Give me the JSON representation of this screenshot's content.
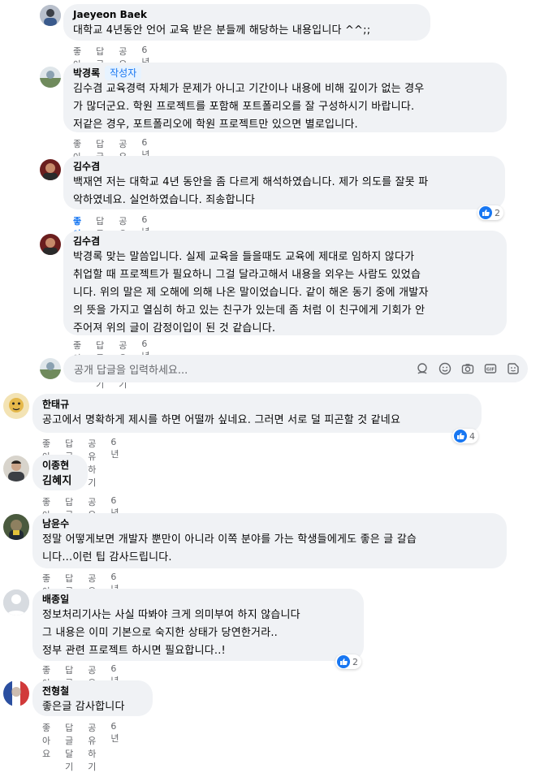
{
  "action_labels": {
    "like": "좋아요",
    "reply": "답글 달기",
    "share": "공유하기"
  },
  "reply_box": {
    "placeholder": "공개 답글을 입력하세요..."
  },
  "comments": [
    {
      "author": "Jaeyeon Baek",
      "text": "대학교 4년동안 언어 교육 받은 분들께 해당하는 내용입니다 ^^;;",
      "time": "6년"
    },
    {
      "author": "박경록",
      "badge": "작성자",
      "text": "김수겸 교육경력 자체가 문제가 아니고 기간이나 내용에 비해 깊이가 없는 경우\n가 많더군요. 학원 프로젝트를 포함해 포트폴리오를 잘 구성하시기 바랍니다.\n저같은 경우, 포트폴리오에 학원 프로젝트만 있으면 별로입니다.",
      "time": "6년"
    },
    {
      "author": "김수겸",
      "text": "백재연 저는 대학교 4년 동안을 좀 다르게 해석하였습니다. 제가 의도를 잘못 파\n악하였네요. 실언하였습니다. 죄송합니다",
      "time": "6년",
      "reactions": "2",
      "liked": true
    },
    {
      "author": "김수겸",
      "text": "박경록 맞는 말씀입니다. 실제 교육을 들을때도 교육에 제대로 임하지 않다가\n취업할 때 프로젝트가 필요하니 그걸 달라고해서 내용을 외우는 사람도 있었습\n니다. 위의 말은 제 오해에 의해 나온 말이었습니다. 같이 해온 동기 중에 개발자\n의 뜻을 가지고 열심히 하고 있는 친구가 있는데 좀 처럼 이 친구에게 기회가 안\n주어져 위의 글이 감정이입이 된 것 같습니다.",
      "time": "6년"
    },
    {
      "author": "한태규",
      "text": "공고에서 명확하게 제시를 하면 어떨까 싶네요. 그러면 서로 덜 피곤할 것 같네요",
      "time": "6년",
      "reactions": "4"
    },
    {
      "author": "이종현",
      "text": "김혜지",
      "time": "6년"
    },
    {
      "author": "남윤수",
      "text": "정말 어떻게보면 개발자 뿐만이 아니라 이쪽 분야를 가는 학생들에게도 좋은 글 갈습\n니다...이런 팁 감사드립니다.",
      "time": "6년"
    },
    {
      "author": "배종일",
      "text": "정보처리기사는 사실 따봐야 크게 의미부여 하지 않습니다\n그 내용은 이미 기본으로 숙지한 상태가 당연한거라..\n정부 관련 프로젝트 하시면 필요합니다..!",
      "time": "6년",
      "reactions": "2"
    },
    {
      "author": "전형철",
      "text": "좋은글 감사합니다",
      "time": "6년"
    }
  ]
}
